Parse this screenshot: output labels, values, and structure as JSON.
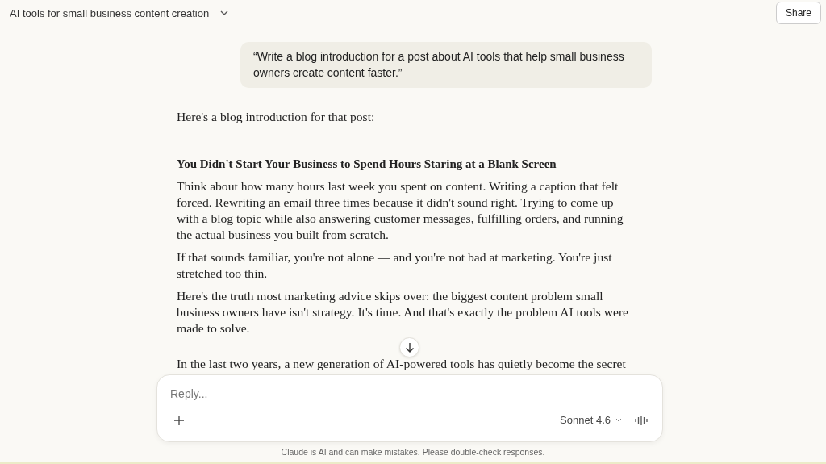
{
  "header": {
    "title": "AI tools for small business content creation",
    "share_label": "Share"
  },
  "user_message": "“Write a blog introduction for a post about AI tools that help small business owners create content faster.”",
  "response": {
    "intro": "Here's a blog introduction for that post:",
    "heading": "You Didn't Start Your Business to Spend Hours Staring at a Blank Screen",
    "paragraphs": [
      "Think about how many hours last week you spent on content. Writing a caption that felt forced. Rewriting an email three times because it didn't sound right. Trying to come up with a blog topic while also answering customer messages, fulfilling orders, and running the actual business you built from scratch.",
      "If that sounds familiar, you're not alone — and you're not bad at marketing. You're just stretched too thin.",
      "Here's the truth most marketing advice skips over: the biggest content problem small business owners have isn't strategy. It's time. And that's exactly the problem AI tools were made to solve.",
      "In the last two years, a new generation of AI-powered tools has quietly become the secret"
    ]
  },
  "composer": {
    "placeholder": "Reply...",
    "model": "Sonnet 4.6"
  },
  "disclaimer": "Claude is AI and can make mistakes. Please double-check responses."
}
